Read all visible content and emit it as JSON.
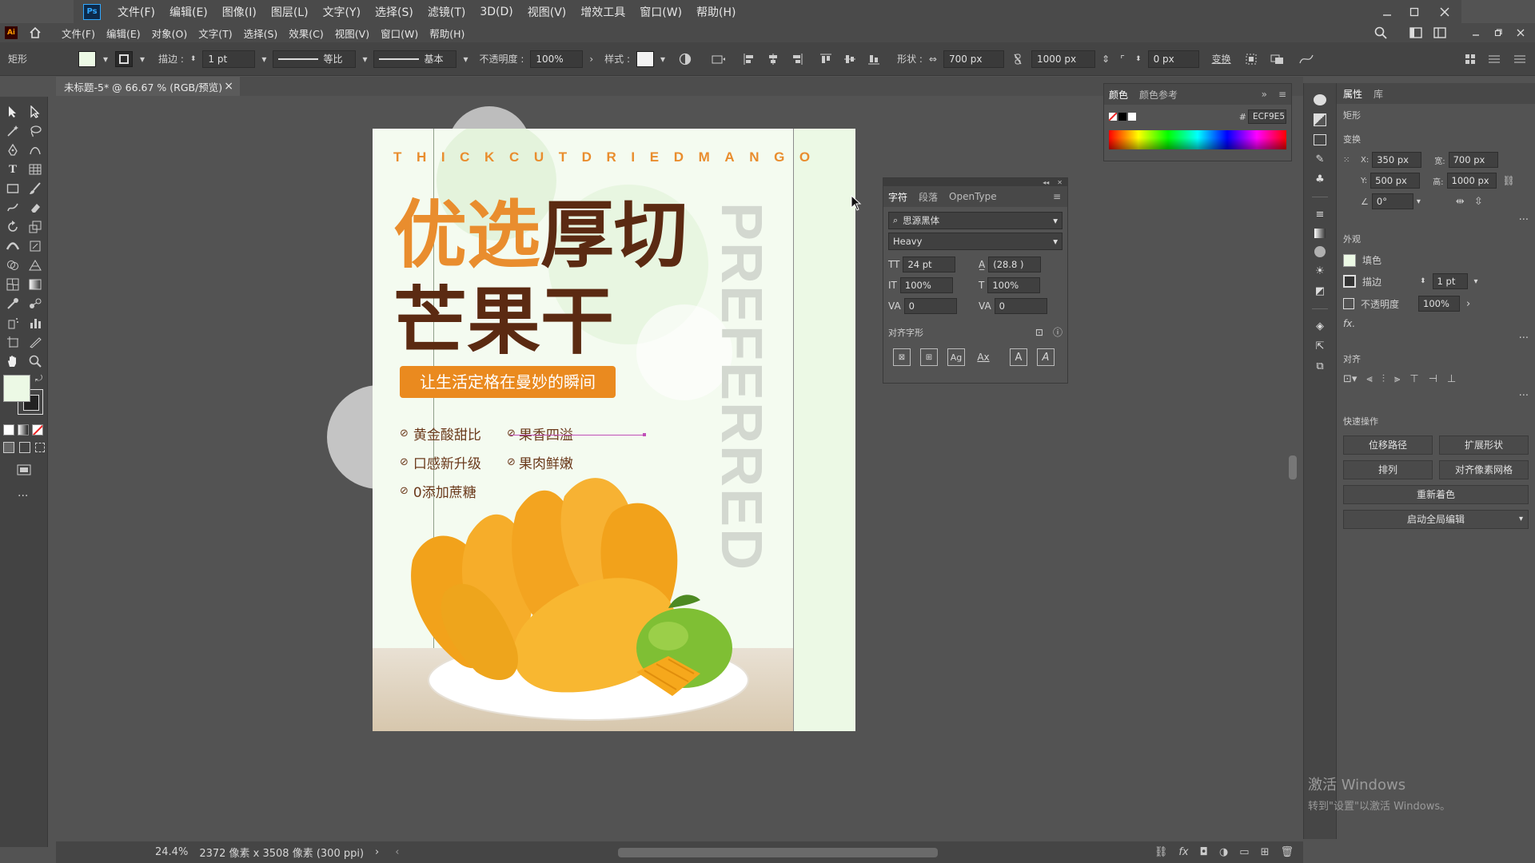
{
  "ps_menu": [
    "文件(F)",
    "编辑(E)",
    "图像(I)",
    "图层(L)",
    "文字(Y)",
    "选择(S)",
    "滤镜(T)",
    "3D(D)",
    "视图(V)",
    "增效工具",
    "窗口(W)",
    "帮助(H)"
  ],
  "ai_menu": [
    "文件(F)",
    "编辑(E)",
    "对象(O)",
    "文字(T)",
    "选择(S)",
    "效果(C)",
    "视图(V)",
    "窗口(W)",
    "帮助(H)"
  ],
  "ctrl": {
    "tool_name": "矩形",
    "stroke_label": "描边 :",
    "stroke_value": "1 pt",
    "stroke_profile": "等比",
    "brush": "基本",
    "opacity_label": "不透明度 :",
    "opacity_value": "100%",
    "style_label": "样式 :",
    "shape_label": "形状 :",
    "width_value": "700 px",
    "height_value": "1000 px",
    "corner_value": "0 px",
    "transform_label": "变换"
  },
  "doc_tab": "未标题-5* @ 66.67 % (RGB/预览)",
  "poster": {
    "top_letters": "THICKCUTDRIEDMANGO",
    "title_orange": "优选",
    "title_brown": "厚切",
    "title_line2": "芒果干",
    "banner": "让生活定格在曼妙的瞬间",
    "features": [
      "黄金酸甜比",
      "口感新升级",
      "0添加蔗糖",
      "果香四溢",
      "果肉鲜嫩"
    ],
    "vertical_word": "PREFERRED"
  },
  "char_panel": {
    "tabs": [
      "字符",
      "段落",
      "OpenType"
    ],
    "font_family": "思源黑体",
    "font_style": "Heavy",
    "font_size": "24 pt",
    "leading": "(28.8 )",
    "vscale": "100%",
    "hscale": "100%",
    "kerning": "0",
    "tracking": "0",
    "glyph_label": "对齐字形"
  },
  "color_panel": {
    "tabs": [
      "颜色",
      "颜色参考"
    ],
    "hex": "ECF9E5"
  },
  "props_panel": {
    "tabs": [
      "属性",
      "库"
    ],
    "object_type": "矩形",
    "transform_label": "变换",
    "x_label": "X:",
    "x": "350 px",
    "y_label": "Y:",
    "y": "500 px",
    "w_label": "宽:",
    "w": "700 px",
    "h_label": "高:",
    "h": "1000 px",
    "angle": "0°",
    "appearance_label": "外观",
    "fill_label": "填色",
    "stroke_label": "描边",
    "stroke_value": "1 pt",
    "opacity_label": "不透明度",
    "opacity_value": "100%",
    "fx_label": "fx.",
    "align_label": "对齐",
    "quick_label": "快速操作",
    "buttons": [
      "位移路径",
      "扩展形状",
      "排列",
      "对齐像素网格",
      "重新着色",
      "启动全局编辑"
    ]
  },
  "status": {
    "zoom": "24.4%",
    "size": "2372 像素 x 3508 像素 (300 ppi)"
  },
  "watermark": {
    "line1": "激活 Windows",
    "line2": "转到\"设置\"以激活 Windows。"
  },
  "colors": {
    "poster_bg": "#ECF9E5",
    "orange": "#E98D2E",
    "brown": "#5B2A12",
    "banner": "#EA8A1F"
  }
}
